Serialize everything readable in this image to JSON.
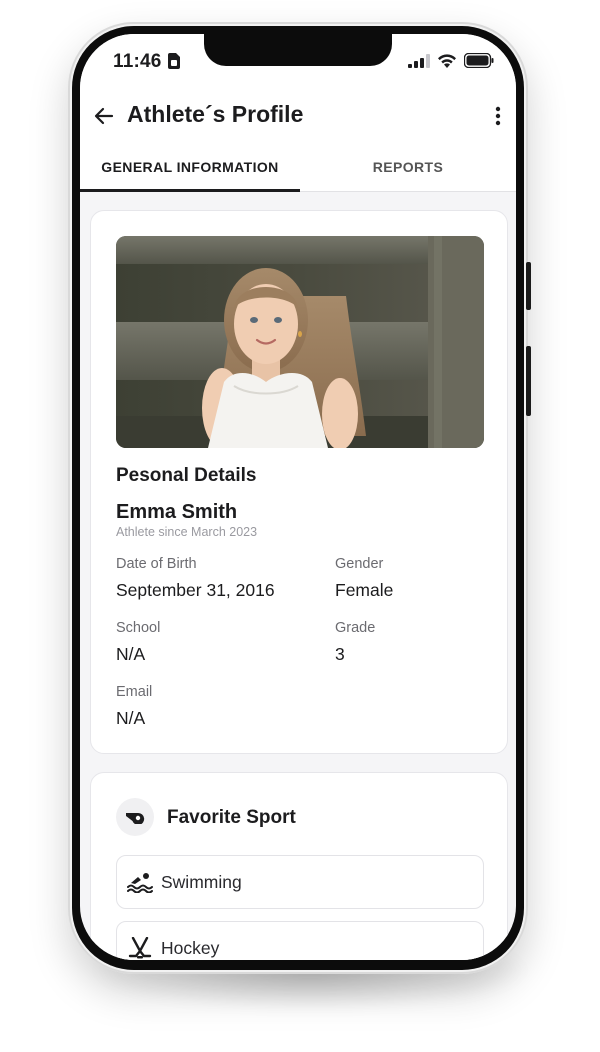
{
  "status_bar": {
    "time": "11:46",
    "sim_icon": "sim-card-icon",
    "signal_icon": "cellular-signal-icon",
    "wifi_icon": "wifi-icon",
    "battery_icon": "battery-icon"
  },
  "header": {
    "title": "Athlete´s Profile",
    "back_icon": "arrow-back-icon",
    "menu_icon": "more-vertical-icon"
  },
  "tabs": [
    {
      "label": "GENERAL INFORMATION",
      "selected": true
    },
    {
      "label": "REPORTS",
      "selected": false
    }
  ],
  "personal": {
    "section_title": "Pesonal Details",
    "name": "Emma Smith",
    "since": "Athlete since March 2023",
    "fields": {
      "dob": {
        "label": "Date of Birth",
        "value": "September 31, 2016"
      },
      "gender": {
        "label": "Gender",
        "value": "Female"
      },
      "school": {
        "label": "School",
        "value": "N/A"
      },
      "grade": {
        "label": "Grade",
        "value": "3"
      },
      "email": {
        "label": "Email",
        "value": "N/A"
      }
    }
  },
  "sports": {
    "title": "Favorite Sport",
    "title_icon": "whistle-icon",
    "items": [
      {
        "label": "Swimming",
        "icon": "swimming-icon"
      },
      {
        "label": "Hockey",
        "icon": "hockey-icon"
      }
    ]
  },
  "colors": {
    "text_primary": "#1c1c1e",
    "text_secondary": "#6b6b70",
    "screen_background": "#f5f5f7",
    "card_border": "#e6e6ea"
  }
}
